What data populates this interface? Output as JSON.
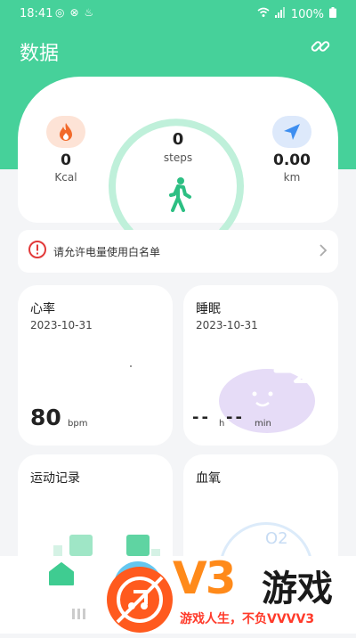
{
  "status_bar": {
    "time": "18:41",
    "battery": "100%"
  },
  "header": {
    "title": "数据"
  },
  "stats": {
    "calories": {
      "value": "0",
      "unit": "Kcal"
    },
    "steps": {
      "value": "0",
      "unit": "steps"
    },
    "distance": {
      "value": "0.00",
      "unit": "km"
    }
  },
  "notice": {
    "text": "请允许电量使用白名单"
  },
  "heart_rate": {
    "title": "心率",
    "date": "2023-10-31",
    "value": "80",
    "unit": "bpm"
  },
  "sleep": {
    "title": "睡眠",
    "date": "2023-10-31",
    "hours": "--",
    "hours_unit": "h",
    "minutes": "--",
    "minutes_unit": "min"
  },
  "exercise": {
    "title": "运动记录"
  },
  "blood_oxygen": {
    "title": "血氧",
    "icon_text": "O2"
  },
  "watermark": {
    "brand": "V3",
    "name": "游戏",
    "slogan": "游戏人生，不负VVVV3"
  },
  "colors": {
    "primary": "#46d19a",
    "accent": "#ff8a1a"
  }
}
